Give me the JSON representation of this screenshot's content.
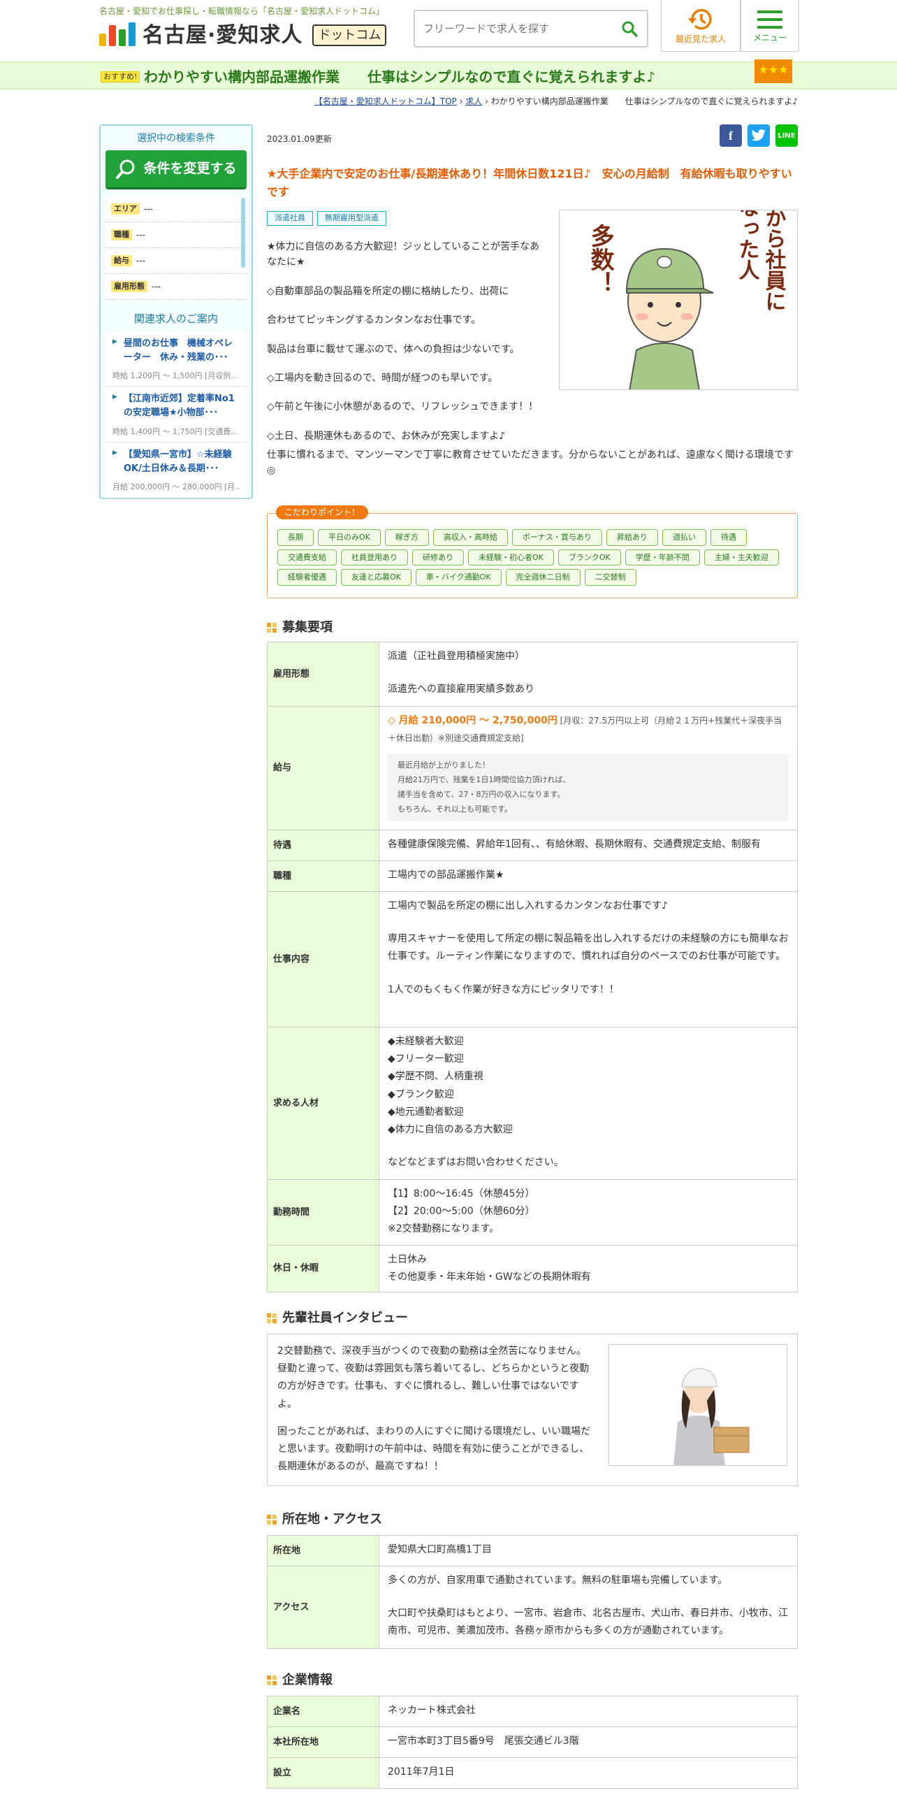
{
  "header": {
    "tagline": "名古屋・愛知でお仕事探し・転職情報なら「名古屋・愛知求人ドットコム」",
    "logo_text": "名古屋·愛知求人",
    "logo_badge": "ドットコム",
    "search_placeholder": "フリーワードで求人を探す",
    "recent_label": "最近見た求人",
    "menu_label": "メニュー"
  },
  "banner": {
    "recommend": "おすすめ!",
    "title": "わかりやすい構内部品運搬作業　　仕事はシンプルなので直ぐに覚えられますよ♪",
    "stars": "★★★"
  },
  "breadcrumb": {
    "home": "【名古屋・愛知求人ドットコム】TOP",
    "jobs": "求人",
    "current": "わかりやすい構内部品運搬作業　　仕事はシンプルなので直ぐに覚えられますよ♪"
  },
  "sidebar": {
    "title": "選択中の検索条件",
    "change_button": "条件を変更する",
    "conditions": [
      {
        "label": "エリア",
        "value": "---"
      },
      {
        "label": "職種",
        "value": "---"
      },
      {
        "label": "給与",
        "value": "---"
      },
      {
        "label": "雇用形態",
        "value": "---"
      }
    ],
    "related_title": "関連求人のご案内",
    "related": [
      {
        "title": "昼間のお仕事　機械オペレーター　休み・残業の･･･",
        "pay": "時給 1,200円 ～ 1,500円 [月収例..."
      },
      {
        "title": "【江南市近郊】定着率No1の安定職場★小物部･･･",
        "pay": "時給 1,400円 ～ 1,750円 [交通費..."
      },
      {
        "title": "【愛知県一宮市】☆未経験OK/土日休み＆長期･･･",
        "pay": "月給 200,000円 ～ 280,000円 [月..."
      }
    ]
  },
  "job": {
    "updated": "2023.01.09更新",
    "share": {
      "facebook": "f",
      "twitter": "t",
      "line": "LINE"
    },
    "title": "★大手企業内で安定のお仕事/長期連休あり！年間休日数121日♪　安心の月給制　有給休暇も取りやすいです",
    "tags": [
      "派遣社員",
      "無期雇用型派遣"
    ],
    "intro": [
      "★体力に自信のある方大歓迎！ジッとしていることが苦手なあなたに★",
      "◇自動車部品の製品箱を所定の棚に格納したり、出荷に",
      "合わせてピッキングするカンタンなお仕事です。",
      "製品は台車に載せて運ぶので、体への負担は少ないです。",
      "◇工場内を動き回るので、時間が経つのも早いです。",
      "◇午前と午後に小休憩があるので、リフレッシュできます！！",
      "◇土日、長期連休もあるので、お休みが充実しますよ♪"
    ],
    "intro_wide": "仕事に慣れるまで、マンツーマンで丁寧に教育させていただきます。分からないことがあれば、遠慮なく聞ける環境です◎",
    "image_text": {
      "line1": "派遣から社員に",
      "line2": "なった人",
      "line3": "多数！"
    },
    "kodawari_title": "こだわりポイント！",
    "kodawari": [
      "長期",
      "平日のみOK",
      "稼ぎ方",
      "高収入・高時給",
      "ボーナス・賞与あり",
      "昇給あり",
      "週払い",
      "待遇",
      "交通費支給",
      "社員登用あり",
      "研修あり",
      "未経験・初心者OK",
      "ブランクOK",
      "学歴・年齢不問",
      "主婦・主夫歓迎",
      "経験者優遇",
      "友達と応募OK",
      "車・バイク通勤OK",
      "完全週休二日制",
      "二交替制"
    ]
  },
  "requirements": {
    "heading": "募集要項",
    "employment_label": "雇用形態",
    "employment_1": "派遣（正社員登用積極実施中）",
    "employment_2": "派遣先への直接雇用実績多数あり",
    "salary_label": "給与",
    "salary_main": "◇ 月給 210,000円 ～ 2,750,000円",
    "salary_note": " [月収：27.5万円以上可（月給２１万円+残業代＋深夜手当＋休日出勤）※別途交通費規定支給]",
    "salary_box": [
      "最近月給が上がりました！",
      "月給21万円で、残業を1日1時間位協力頂ければ、",
      "諸手当を含めて、27・8万円の収入になります。",
      "もちろん、それ以上も可能です。"
    ],
    "benefits_label": "待遇",
    "benefits": "各種健康保険完備、昇給年1回有、、有給休暇、長期休暇有、交通費規定支給、制服有",
    "job_type_label": "職種",
    "job_type": "工場内での部品運搬作業★",
    "content_label": "仕事内容",
    "content_1": "工場内で製品を所定の棚に出し入れするカンタンなお仕事です♪",
    "content_2": "専用スキャナーを使用して所定の棚に製品箱を出し入れするだけの未経験の方にも簡単なお仕事です。ルーティン作業になりますので、慣れれば自分のペースでのお仕事が可能です。",
    "content_3": "1人でのもくもく作業が好きな方にピッタリです！！",
    "wanted_label": "求める人材",
    "wanted": [
      "◆未経験者大歓迎",
      "◆フリーター歓迎",
      "◆学歴不問、人柄重視",
      "◆ブランク歓迎",
      "◆地元通勤者歓迎",
      "◆体力に自信のある方大歓迎"
    ],
    "wanted_note": "などなどまずはお問い合わせください。",
    "hours_label": "勤務時間",
    "hours": [
      "【1】8:00～16:45（休憩45分）",
      "【2】20:00～5:00（休憩60分）",
      "※2交替勤務になります。"
    ],
    "holiday_label": "休日・休暇",
    "holiday": [
      "土日休み",
      "その他夏季・年末年始・GWなどの長期休暇有"
    ]
  },
  "interview": {
    "heading": "先輩社員インタビュー",
    "p1": "2交替勤務で、深夜手当がつくので夜勤の勤務は全然苦になりません。昼勤と違って、夜勤は雰囲気も落ち着いてるし、どちらかというと夜勤の方が好きです。仕事も、すぐに慣れるし、難しい仕事ではないですよ。",
    "p2": "困ったことがあれば、まわりの人にすぐに聞ける環境だし、いい職場だと思います。夜勤明けの午前中は、時間を有効に使うことができるし、長期連休があるのが、最高ですね！！"
  },
  "location": {
    "heading": "所在地・アクセス",
    "address_label": "所在地",
    "address": "愛知県大口町高橋1丁目",
    "access_label": "アクセス",
    "access_1": "多くの方が、自家用車で通勤されています。無料の駐車場も完備しています。",
    "access_2": "大口町や扶桑町はもとより、一宮市、岩倉市、北名古屋市、犬山市、春日井市、小牧市、江南市、可児市、美濃加茂市、各務ヶ原市からも多くの方が通勤されています。"
  },
  "company": {
    "heading": "企業情報",
    "name_label": "企業名",
    "name": "ネッカート株式会社",
    "hq_label": "本社所在地",
    "hq": "一宮市本町3丁目5番9号　尾張交通ビル3階",
    "est_label": "設立",
    "est": "2011年7月1日"
  }
}
